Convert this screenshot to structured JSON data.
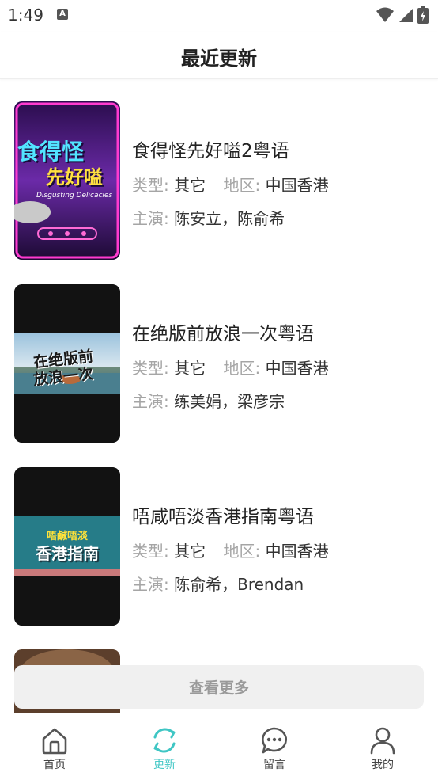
{
  "status": {
    "time": "1:49",
    "notif_glyph": "A"
  },
  "header": {
    "title": "最近更新"
  },
  "labels": {
    "type": "类型",
    "region": "地区",
    "cast": "主演",
    "colon": ":"
  },
  "items": [
    {
      "title": "食得怪先好嗌2粤语",
      "type": "其它",
      "region": "中国香港",
      "cast": "陈安立，陈俞希",
      "poster": {
        "line1": "食得怪",
        "line2": "先好嗌",
        "sub": "Disgusting Delicacies"
      }
    },
    {
      "title": "在绝版前放浪一次粤语",
      "type": "其它",
      "region": "中国香港",
      "cast": "练美娟，梁彦宗",
      "poster": {
        "line1": "在绝版前",
        "line2": "放浪一次"
      }
    },
    {
      "title": "唔咸唔淡香港指南粤语",
      "type": "其它",
      "region": "中国香港",
      "cast": "陈俞希，Brendan",
      "poster": {
        "line1": "唔鹹唔淡",
        "line2": "香港指南"
      }
    }
  ],
  "more_button": {
    "label": "查看更多"
  },
  "tabs": [
    {
      "label": "首页",
      "icon": "home-icon",
      "active": false
    },
    {
      "label": "更新",
      "icon": "refresh-icon",
      "active": true
    },
    {
      "label": "留言",
      "icon": "chat-bubble-icon",
      "active": false
    },
    {
      "label": "我的",
      "icon": "user-icon",
      "active": false
    }
  ],
  "colors": {
    "accent": "#3fc6c4",
    "muted": "#a5a5a5",
    "text": "#222222"
  }
}
